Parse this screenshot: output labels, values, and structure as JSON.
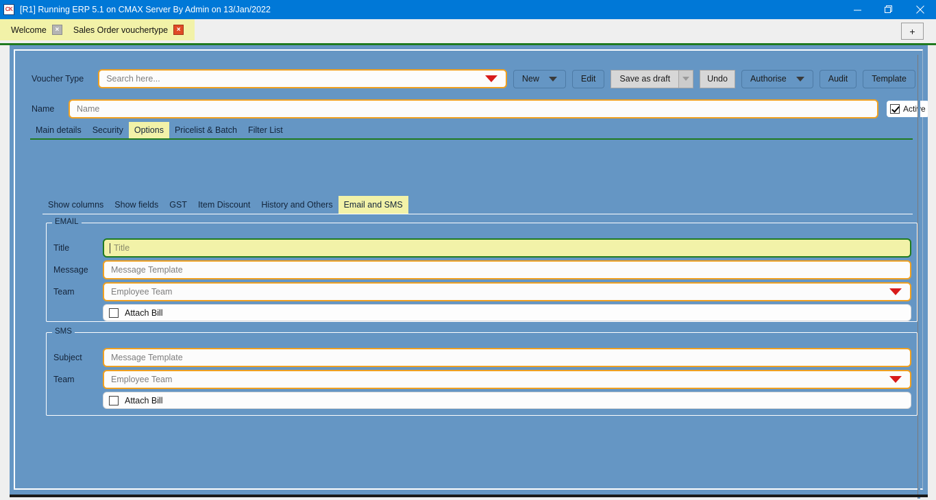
{
  "window": {
    "title": "[R1] Running ERP 5.1 on CMAX Server By Admin on 13/Jan/2022",
    "app_icon": "CK",
    "minimize": "minimize-icon",
    "maximize": "restore-icon",
    "close": "close-icon",
    "accent_color": "#0078d7"
  },
  "tabbar": {
    "tabs": [
      {
        "label": "Welcome",
        "close": "×",
        "active": false
      },
      {
        "label": "Sales Order vouchertype",
        "close": "×",
        "active": true
      }
    ],
    "new_tab_label": "+",
    "tabstrip_color": "#f2f2a8"
  },
  "form": {
    "voucher_type_label": "Voucher Type",
    "voucher_type_placeholder": "Search here...",
    "name_label": "Name",
    "name_placeholder": "Name",
    "active_label": "Active",
    "active_checked": true
  },
  "toolbar": {
    "new_label": "New",
    "edit_label": "Edit",
    "save_as_draft_label": "Save as draft",
    "undo_label": "Undo",
    "authorise_label": "Authorise",
    "audit_label": "Audit",
    "template_label": "Template"
  },
  "main_tabs": [
    {
      "label": "Main details",
      "selected": false
    },
    {
      "label": "Security",
      "selected": false
    },
    {
      "label": "Options",
      "selected": true
    },
    {
      "label": "Pricelist & Batch",
      "selected": false
    },
    {
      "label": "Filter List",
      "selected": false
    }
  ],
  "sub_tabs": [
    {
      "label": "Show columns",
      "selected": false
    },
    {
      "label": "Show fields",
      "selected": false
    },
    {
      "label": "GST",
      "selected": false
    },
    {
      "label": "Item Discount",
      "selected": false
    },
    {
      "label": "History and Others",
      "selected": false
    },
    {
      "label": "Email and SMS",
      "selected": true
    }
  ],
  "email_group": {
    "legend": "EMAIL",
    "title_label": "Title",
    "title_placeholder": "Title",
    "message_label": "Message",
    "message_placeholder": "Message Template",
    "team_label": "Team",
    "team_placeholder": "Employee Team",
    "attach_bill_label": "Attach Bill",
    "attach_bill_checked": false
  },
  "sms_group": {
    "legend": "SMS",
    "subject_label": "Subject",
    "subject_placeholder": "Message Template",
    "team_label": "Team",
    "team_placeholder": "Employee Team",
    "attach_bill_label": "Attach Bill",
    "attach_bill_checked": false
  },
  "colors": {
    "background_blue": "#6596c4",
    "field_border_orange": "#f0a020",
    "focus_yellow": "#f2f2a8",
    "focus_border_green": "#1f7a1f",
    "dropdown_red": "#d81b1b"
  }
}
